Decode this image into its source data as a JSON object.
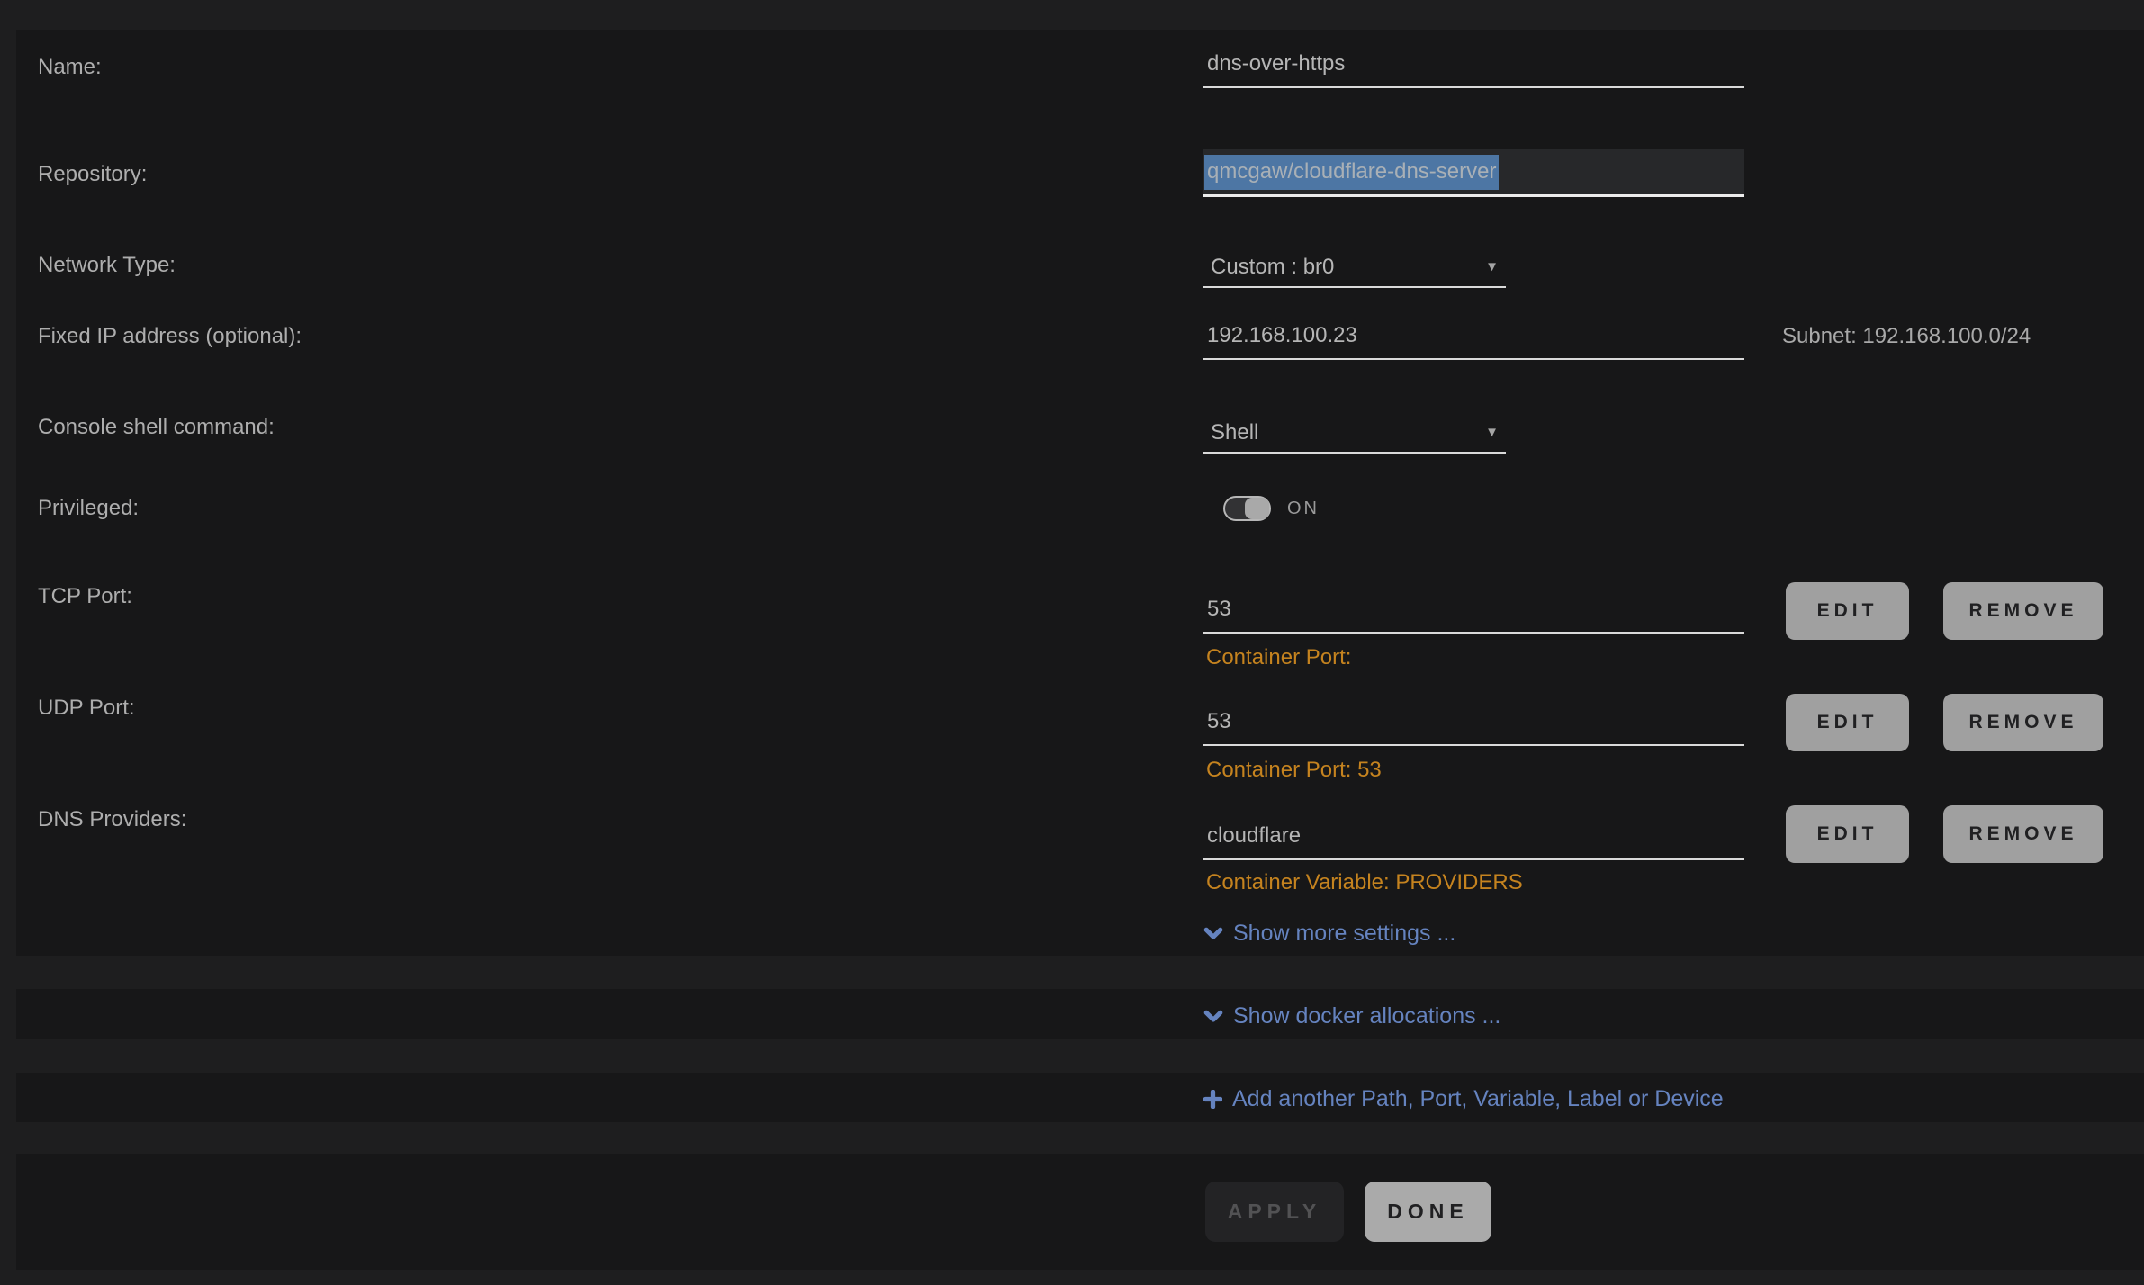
{
  "theme": {
    "accent_orange": "#c5831f",
    "link_blue": "#6583bf",
    "selection_blue": "#4d76a4",
    "row_background": "#171718",
    "page_background": "#1e1e1f"
  },
  "icons": {
    "dropdown_caret": "▼"
  },
  "form": {
    "name": {
      "label": "Name:",
      "value": "dns-over-https"
    },
    "repository": {
      "label": "Repository:",
      "value": "qmcgaw/cloudflare-dns-server"
    },
    "network_type": {
      "label": "Network Type:",
      "value": "Custom : br0"
    },
    "fixed_ip": {
      "label": "Fixed IP address (optional):",
      "value": "192.168.100.23",
      "subnet_note": "Subnet: 192.168.100.0/24"
    },
    "console_shell": {
      "label": "Console shell command:",
      "value": "Shell"
    },
    "privileged": {
      "label": "Privileged:",
      "state_label": "ON"
    },
    "tcp_port": {
      "label": "TCP Port:",
      "value": "53",
      "note": "Container Port:"
    },
    "udp_port": {
      "label": "UDP Port:",
      "value": "53",
      "note": "Container Port: 53"
    },
    "dns_providers": {
      "label": "DNS Providers:",
      "value": "cloudflare",
      "note": "Container Variable: PROVIDERS"
    },
    "row_buttons": {
      "edit": "EDIT",
      "remove": "REMOVE"
    },
    "links": {
      "show_more": "Show more settings ...",
      "show_docker": "Show docker allocations ...",
      "add_another": "Add another Path, Port, Variable, Label or Device"
    },
    "actions": {
      "apply": "APPLY",
      "done": "DONE"
    }
  }
}
